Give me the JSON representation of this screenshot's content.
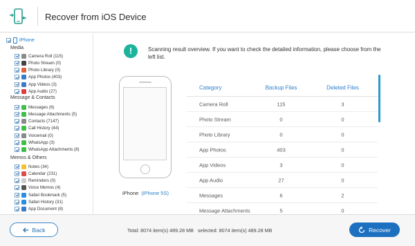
{
  "header": {
    "title": "Recover from iOS Device",
    "icon": "phone-transfer-icon"
  },
  "sidebar": {
    "root": {
      "label": "iPhone",
      "icon": "phone-icon"
    },
    "groups": [
      {
        "label": "Media",
        "items": [
          {
            "label": "Camera Roll (115)",
            "icon": "camera-roll-icon",
            "color": "#8a8a8a"
          },
          {
            "label": "Photo Stream (0)",
            "icon": "photo-stream-icon",
            "color": "#444444"
          },
          {
            "label": "Photo Library (0)",
            "icon": "photo-library-icon",
            "color": "#e0623a"
          },
          {
            "label": "App Photos (403)",
            "icon": "app-photos-icon",
            "color": "#3a7cc8"
          },
          {
            "label": "App Videos (3)",
            "icon": "app-videos-icon",
            "color": "#3a7cc8"
          },
          {
            "label": "App Audio (27)",
            "icon": "app-audio-icon",
            "color": "#e23a3a"
          }
        ]
      },
      {
        "label": "Message & Contacts",
        "items": [
          {
            "label": "Messages (6)",
            "icon": "messages-icon",
            "color": "#3fbf4a"
          },
          {
            "label": "Message Attachments (5)",
            "icon": "message-attachments-icon",
            "color": "#3fbf4a"
          },
          {
            "label": "Contacts (7147)",
            "icon": "contacts-icon",
            "color": "#8a8a8a"
          },
          {
            "label": "Call History (44)",
            "icon": "call-history-icon",
            "color": "#3fbf4a"
          },
          {
            "label": "Voicemail (0)",
            "icon": "voicemail-icon",
            "color": "#888888"
          },
          {
            "label": "WhatsApp (3)",
            "icon": "whatsapp-icon",
            "color": "#3fbf4a"
          },
          {
            "label": "WhatsApp Attachments (8)",
            "icon": "whatsapp-attachments-icon",
            "color": "#3fbf4a"
          }
        ]
      },
      {
        "label": "Memos & Others",
        "items": [
          {
            "label": "Notes (34)",
            "icon": "notes-icon",
            "color": "#f2c230"
          },
          {
            "label": "Calendar (231)",
            "icon": "calendar-icon",
            "color": "#e04a4a"
          },
          {
            "label": "Reminders (0)",
            "icon": "reminders-icon",
            "color": "#cccccc"
          },
          {
            "label": "Voice Memos (4)",
            "icon": "voice-memos-icon",
            "color": "#555555"
          },
          {
            "label": "Safari Bookmark (5)",
            "icon": "safari-bookmark-icon",
            "color": "#2a8de0"
          },
          {
            "label": "Safari History (31)",
            "icon": "safari-history-icon",
            "color": "#2a8de0"
          },
          {
            "label": "App Document (8)",
            "icon": "app-document-icon",
            "color": "#3a7cc8"
          }
        ]
      }
    ]
  },
  "main": {
    "info_text": "Scanning result overview. If you want to check the detailed information, please choose from the left list.",
    "device": {
      "label": "iPhone",
      "model": "(iPhone 5S)"
    },
    "table": {
      "headers": [
        "Category",
        "Backup Files",
        "Deleted Files"
      ],
      "rows": [
        [
          "Camera Roll",
          "115",
          "3"
        ],
        [
          "Photo Stream",
          "0",
          "0"
        ],
        [
          "Photo Library",
          "0",
          "0"
        ],
        [
          "App Photos",
          "403",
          "0"
        ],
        [
          "App Videos",
          "3",
          "0"
        ],
        [
          "App Audio",
          "27",
          "0"
        ],
        [
          "Messages",
          "6",
          "2"
        ],
        [
          "Message Attachments",
          "5",
          "0"
        ]
      ]
    }
  },
  "footer": {
    "back_label": "Back",
    "total": "Total: 8074 item(s) 489.28 MB",
    "selected": "selected: 8074 item(s) 489.28 MB",
    "recover_label": "Recover"
  },
  "colors": {
    "accent": "#1d6fc0",
    "info": "#1bb39b",
    "link": "#2a7fc9"
  }
}
